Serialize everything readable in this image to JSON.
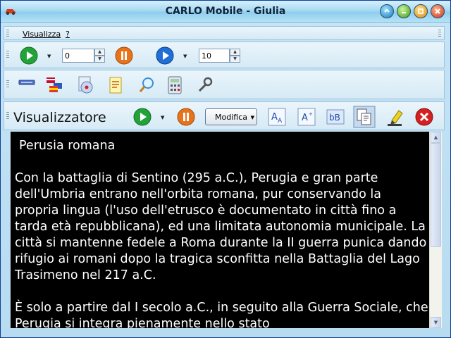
{
  "window": {
    "title": "CARLO Mobile - Giulia"
  },
  "menu": {
    "items": [
      "Visualizza",
      "?"
    ]
  },
  "toolbar1": {
    "left_value": "0",
    "right_value": "10"
  },
  "viewer": {
    "title": "Visualizzatore",
    "mode_label": "Modifica",
    "heading": "Perusia romana",
    "paragraphs": [
      "Con la battaglia di Sentino (295 a.C.), Perugia e gran parte dell'Umbria entrano nell'orbita romana, pur conservando la propria lingua (l'uso dell'etrusco è documentato in città fino a tarda età repubblicana), ed una limitata autonomia municipale. La città si mantenne fedele a Roma durante la II guerra punica dando rifugio ai romani dopo la tragica sconfitta nella Battaglia del Lago Trasimeno nel 217 a.C.",
      "È solo a partire dal I secolo a.C., in seguito alla Guerra Sociale, che Perugia si integra pienamente nello stato"
    ]
  },
  "icons": {
    "toolbar2": [
      "keyboard-icon",
      "flags-icon",
      "media-cd-icon",
      "notepad-icon",
      "magnifier-icon",
      "calculator-icon",
      "wrench-icon"
    ],
    "viewer": [
      "play-icon",
      "pause-icon",
      "font-size-a-icon",
      "font-style-a-icon",
      "case-bb-icon",
      "copy-page-icon",
      "highlighter-icon",
      "close-red-icon"
    ]
  },
  "colors": {
    "play": "#22a33a",
    "pause": "#e8731a",
    "blue_play": "#1f6fd6",
    "close": "#d42020",
    "text_bg": "#000000",
    "text_fg": "#ffffff"
  }
}
